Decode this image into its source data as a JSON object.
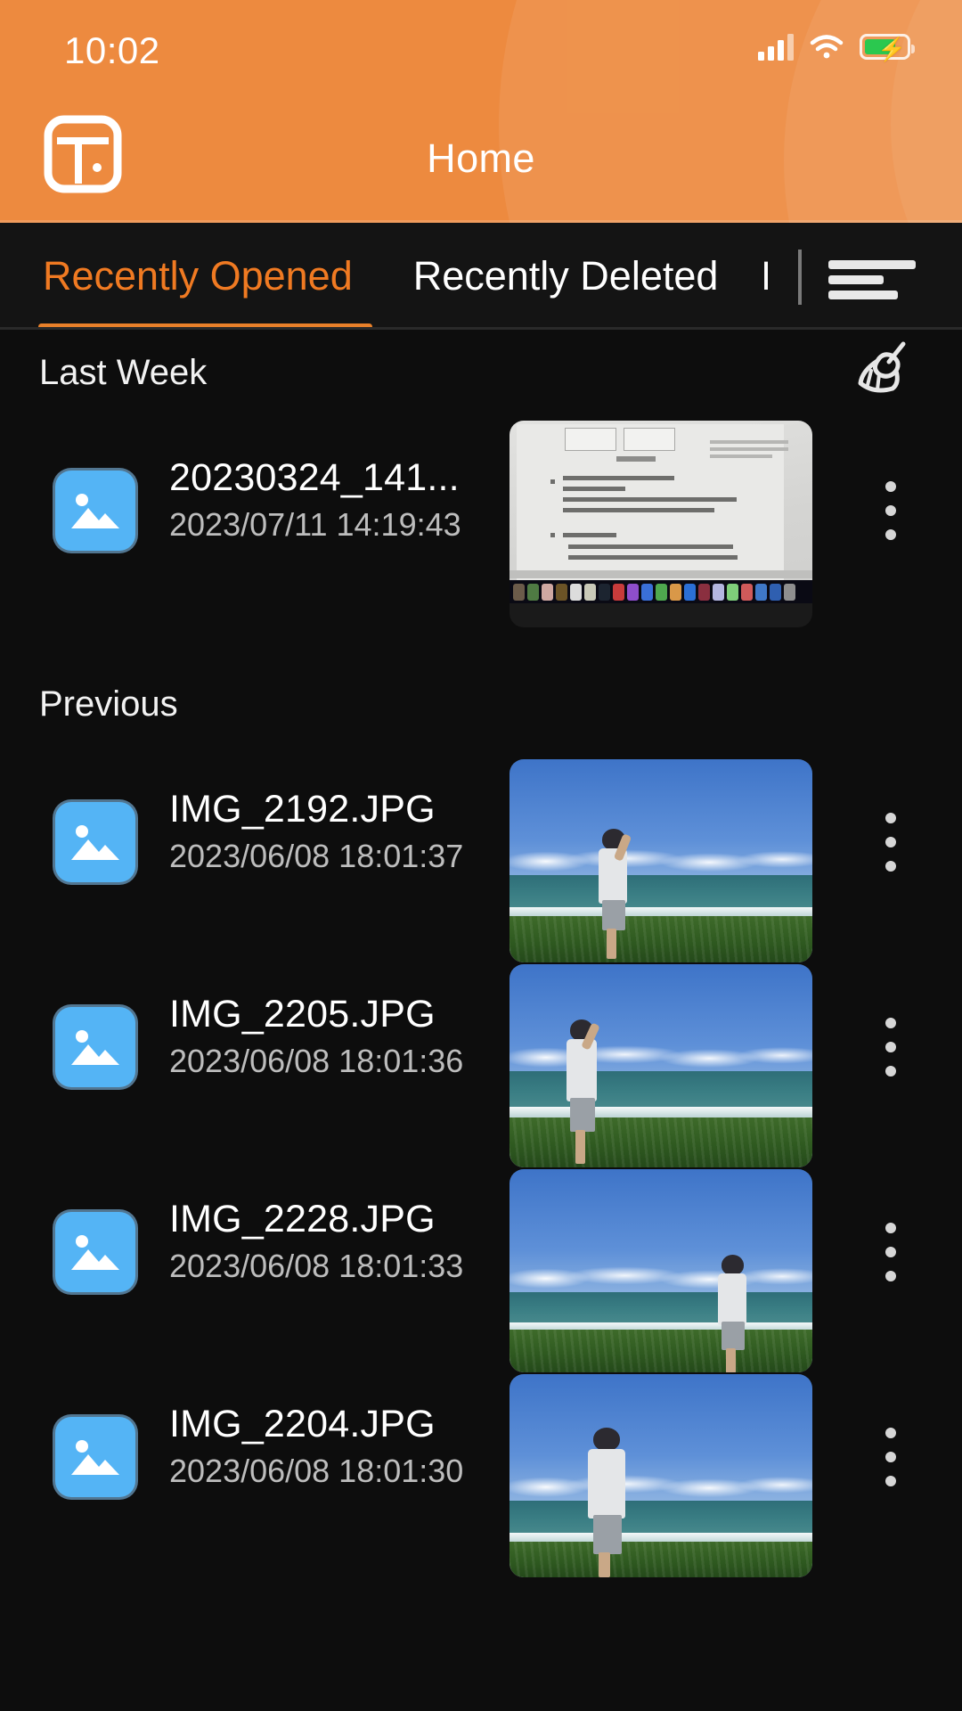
{
  "status_bar": {
    "time": "10:02",
    "signal_icon": "cellular-signal-icon",
    "wifi_icon": "wifi-icon",
    "battery_icon": "battery-charging-icon",
    "battery_color": "#2BC84F"
  },
  "header": {
    "title": "Home",
    "menu_icon": "layout-panel-icon",
    "background_color": "#ED8A3F"
  },
  "tabs": {
    "items": [
      {
        "label": "Recently Opened",
        "active": true
      },
      {
        "label": "Recently Deleted",
        "active": false
      },
      {
        "label": "R",
        "active": false
      }
    ],
    "active_color": "#F07A22",
    "sort_icon": "sort-lines-icon"
  },
  "sections": [
    {
      "title": "Last Week",
      "action_icon": "broom-icon",
      "files": [
        {
          "name": "20230324_141...",
          "date": "2023/07/11 14:19:43",
          "type_icon": "image-file-icon",
          "menu_icon": "kebab-menu-icon",
          "thumbnail": "document-screenshot"
        }
      ]
    },
    {
      "title": "Previous",
      "action_icon": "",
      "files": [
        {
          "name": "IMG_2192.JPG",
          "date": "2023/06/08 18:01:37",
          "type_icon": "image-file-icon",
          "menu_icon": "kebab-menu-icon",
          "thumbnail": "beach-person-center"
        },
        {
          "name": "IMG_2205.JPG",
          "date": "2023/06/08 18:01:36",
          "type_icon": "image-file-icon",
          "menu_icon": "kebab-menu-icon",
          "thumbnail": "beach-person-left"
        },
        {
          "name": "IMG_2228.JPG",
          "date": "2023/06/08 18:01:33",
          "type_icon": "image-file-icon",
          "menu_icon": "kebab-menu-icon",
          "thumbnail": "beach-person-right"
        },
        {
          "name": "IMG_2204.JPG",
          "date": "2023/06/08 18:01:30",
          "type_icon": "image-file-icon",
          "menu_icon": "kebab-menu-icon",
          "thumbnail": "beach-person-center-low"
        }
      ]
    }
  ]
}
